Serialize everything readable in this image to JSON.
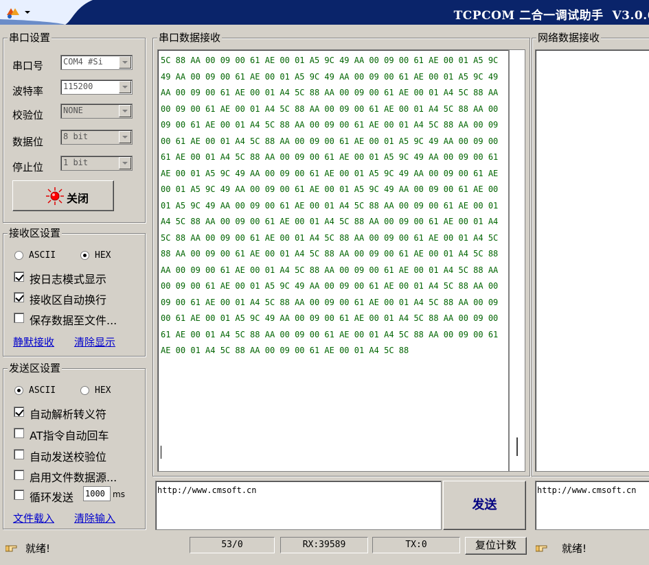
{
  "window": {
    "title": "TCPCOM 二合一调试助手  V3.0.6"
  },
  "serial_settings": {
    "group_title": "串口设置",
    "port": {
      "label": "串口号",
      "value": "COM4 #Si"
    },
    "baud": {
      "label": "波特率",
      "value": "115200"
    },
    "parity": {
      "label": "校验位",
      "value": "NONE"
    },
    "data_bits": {
      "label": "数据位",
      "value": "8 bit"
    },
    "stop_bits": {
      "label": "停止位",
      "value": "1 bit"
    },
    "open_close_button": "关闭"
  },
  "receive_settings": {
    "group_title": "接收区设置",
    "ascii_label": "ASCII",
    "hex_label": "HEX",
    "selected_mode": "HEX",
    "log_mode": {
      "label": "按日志模式显示",
      "checked": true
    },
    "auto_wrap": {
      "label": "接收区自动换行",
      "checked": true
    },
    "save_to_file": {
      "label": "保存数据至文件...",
      "checked": false
    },
    "silent_receive_link": "静默接收",
    "clear_display_link": "清除显示"
  },
  "send_settings": {
    "group_title": "发送区设置",
    "ascii_label": "ASCII",
    "hex_label": "HEX",
    "selected_mode": "ASCII",
    "auto_escape": {
      "label": "自动解析转义符",
      "checked": true
    },
    "at_auto_enter": {
      "label": "AT指令自动回车",
      "checked": false
    },
    "auto_checksum": {
      "label": "自动发送校验位",
      "checked": false
    },
    "file_data_source": {
      "label": "启用文件数据源...",
      "checked": false
    },
    "loop_send": {
      "label": "循环发送",
      "checked": false,
      "interval": "1000",
      "unit": "ms"
    },
    "load_file_link": "文件载入",
    "clear_input_link": "清除输入"
  },
  "serial_receive": {
    "group_title": "串口数据接收",
    "content": "5C 88 AA 00 09 00 61 AE 00 01 A5 9C 49 AA 00 09 00 61 AE 00 01 A5 9C 49 AA 00 09 00 61 AE 00 01 A5 9C 49 AA 00 09 00 61 AE 00 01 A5 9C 49 AA 00 09 00 61 AE 00 01 A4 5C 88 AA 00 09 00 61 AE 00 01 A4 5C 88 AA 00 09 00 61 AE 00 01 A4 5C 88 AA 00 09 00 61 AE 00 01 A4 5C 88 AA 00 09 00 61 AE 00 01 A4 5C 88 AA 00 09 00 61 AE 00 01 A4 5C 88 AA 00 09 00 61 AE 00 01 A4 5C 88 AA 00 09 00 61 AE 00 01 A5 9C 49 AA 00 09 00 61 AE 00 01 A4 5C 88 AA 00 09 00 61 AE 00 01 A5 9C 49 AA 00 09 00 61 AE 00 01 A5 9C 49 AA 00 09 00 61 AE 00 01 A5 9C 49 AA 00 09 00 61 AE 00 01 A5 9C 49 AA 00 09 00 61 AE 00 01 A5 9C 49 AA 00 09 00 61 AE 00 01 A5 9C 49 AA 00 09 00 61 AE 00 01 A4 5C 88 AA 00 09 00 61 AE 00 01 A4 5C 88 AA 00 09 00 61 AE 00 01 A4 5C 88 AA 00 09 00 61 AE 00 01 A4 5C 88 AA 00 09 00 61 AE 00 01 A4 5C 88 AA 00 09 00 61 AE 00 01 A4 5C 88 AA 00 09 00 61 AE 00 01 A4 5C 88 AA 00 09 00 61 AE 00 01 A4 5C 88 AA 00 09 00 61 AE 00 01 A4 5C 88 AA 00 09 00 61 AE 00 01 A4 5C 88 AA 00 09 00 61 AE 00 01 A5 9C 49 AA 00 09 00 61 AE 00 01 A4 5C 88 AA 00 09 00 61 AE 00 01 A4 5C 88 AA 00 09 00 61 AE 00 01 A4 5C 88 AA 00 09 00 61 AE 00 01 A5 9C 49 AA 00 09 00 61 AE 00 01 A4 5C 88 AA 00 09 00 61 AE 00 01 A4 5C 88 AA 00 09 00 61 AE 00 01 A4 5C 88 AA 00 09 00 61 AE 00 01 A4 5C 88 AA 00 09 00 61 AE 00 01 A4 5C 88"
  },
  "network_receive": {
    "group_title": "网络数据接收"
  },
  "send_area": {
    "text": "http://www.cmsoft.cn",
    "send_button": "发送"
  },
  "network_send": {
    "text": "http://www.cmsoft.cn"
  },
  "status": {
    "left_text": "就绪!",
    "count": "53/0",
    "rx": "RX:39589",
    "tx": "TX:0",
    "reset_button": "复位计数",
    "right_text": "就绪!"
  }
}
